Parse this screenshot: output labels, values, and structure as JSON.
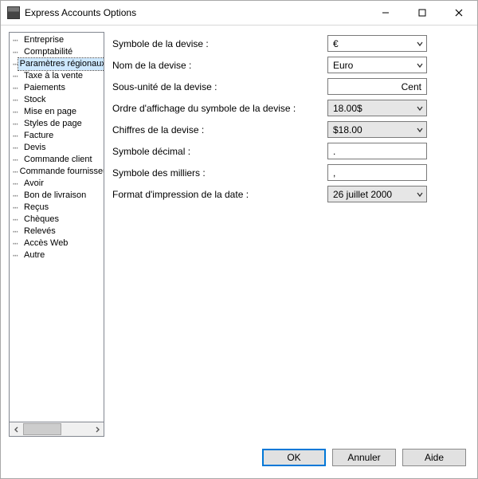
{
  "window": {
    "title": "Express Accounts Options"
  },
  "sidebar": {
    "items": [
      {
        "label": "Entreprise"
      },
      {
        "label": "Comptabilité"
      },
      {
        "label": "Paramètres régionaux",
        "selected": true
      },
      {
        "label": "Taxe à la vente"
      },
      {
        "label": "Paiements"
      },
      {
        "label": "Stock"
      },
      {
        "label": "Mise en page"
      },
      {
        "label": "Styles de page"
      },
      {
        "label": "Facture"
      },
      {
        "label": "Devis"
      },
      {
        "label": "Commande client"
      },
      {
        "label": "Commande fournisseur"
      },
      {
        "label": "Avoir"
      },
      {
        "label": "Bon de livraison"
      },
      {
        "label": "Reçus"
      },
      {
        "label": "Chèques"
      },
      {
        "label": "Relevés"
      },
      {
        "label": "Accès Web"
      },
      {
        "label": "Autre"
      }
    ]
  },
  "form": {
    "currency_symbol": {
      "label": "Symbole de la devise :",
      "value": "€",
      "type": "combo"
    },
    "currency_name": {
      "label": "Nom de la devise :",
      "value": "Euro",
      "type": "combo"
    },
    "currency_subunit": {
      "label": "Sous-unité de la devise :",
      "value": "Cent",
      "type": "text-right"
    },
    "symbol_order": {
      "label": "Ordre d'affichage du symbole de la devise :",
      "value": "18.00$",
      "type": "combo-grey"
    },
    "currency_digits": {
      "label": "Chiffres de la devise :",
      "value": "$18.00",
      "type": "combo-grey"
    },
    "decimal_symbol": {
      "label": "Symbole décimal :",
      "value": ".",
      "type": "text"
    },
    "thousands_symbol": {
      "label": "Symbole des milliers :",
      "value": ",",
      "type": "text"
    },
    "date_format": {
      "label": "Format d'impression de la date :",
      "value": "26 juillet 2000",
      "type": "combo-grey"
    }
  },
  "footer": {
    "ok": "OK",
    "cancel": "Annuler",
    "help": "Aide"
  }
}
